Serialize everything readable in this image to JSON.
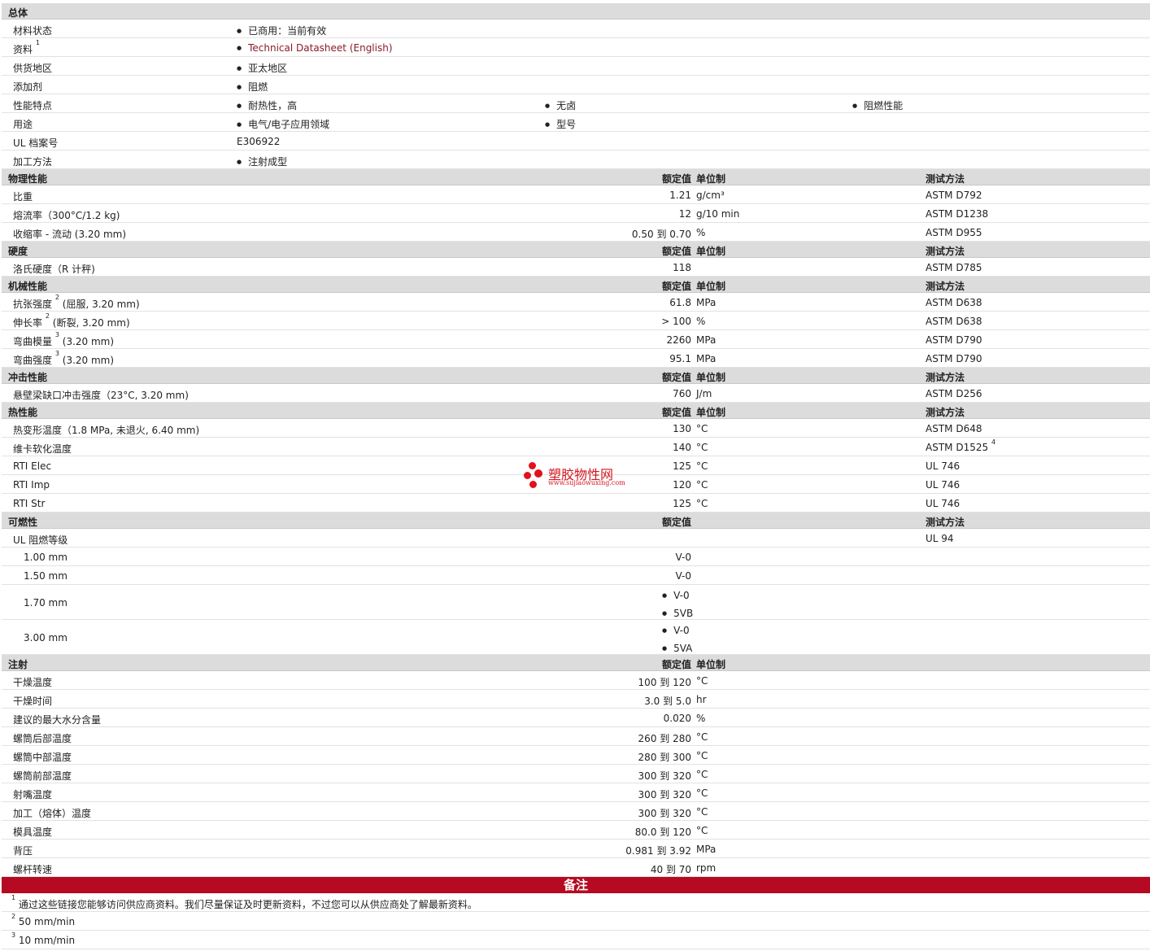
{
  "general": {
    "title": "总体",
    "status_label": "材料状态",
    "status_value": "已商用：当前有效",
    "docs_label": "资料",
    "docs_sup": "1",
    "docs_value": "Technical Datasheet (English)",
    "region_label": "供货地区",
    "region_value": "亚太地区",
    "additive_label": "添加剂",
    "additive_value": "阻燃",
    "features_label": "性能特点",
    "features": [
      "耐热性，高",
      "无卤",
      "阻燃性能"
    ],
    "uses_label": "用途",
    "uses": [
      "电气/电子应用领域",
      "型号"
    ],
    "ul_label": "UL 档案号",
    "ul_value": "E306922",
    "process_label": "加工方法",
    "process_value": "注射成型"
  },
  "headers": {
    "nominal": "额定值",
    "unit": "单位制",
    "test": "测试方法"
  },
  "physical": {
    "title": "物理性能",
    "rows": [
      {
        "label": "比重",
        "value": "1.21",
        "unit": "g/cm³",
        "test": "ASTM D792"
      },
      {
        "label": "熔流率（300°C/1.2 kg)",
        "value": "12",
        "unit": "g/10 min",
        "test": "ASTM D1238"
      },
      {
        "label": "收缩率 - 流动 (3.20 mm)",
        "value": "0.50 到  0.70",
        "unit": "%",
        "test": "ASTM D955"
      }
    ]
  },
  "hardness": {
    "title": "硬度",
    "rows": [
      {
        "label": "洛氏硬度（R 计秤)",
        "value": "118",
        "unit": "",
        "test": "ASTM D785"
      }
    ]
  },
  "mechanical": {
    "title": "机械性能",
    "rows": [
      {
        "label": "抗张强度",
        "sup": "2",
        "suffix": "(屈服, 3.20 mm)",
        "value": "61.8",
        "unit": "MPa",
        "test": "ASTM D638"
      },
      {
        "label": "伸长率",
        "sup": "2",
        "suffix": "(断裂, 3.20 mm)",
        "value": "> 100",
        "unit": "%",
        "test": "ASTM D638"
      },
      {
        "label": "弯曲模量",
        "sup": "3",
        "suffix": "(3.20 mm)",
        "value": "2260",
        "unit": "MPa",
        "test": "ASTM D790"
      },
      {
        "label": "弯曲强度",
        "sup": "3",
        "suffix": "(3.20 mm)",
        "value": "95.1",
        "unit": "MPa",
        "test": "ASTM D790"
      }
    ]
  },
  "impact": {
    "title": "冲击性能",
    "rows": [
      {
        "label": "悬壁梁缺口冲击强度（23°C, 3.20 mm)",
        "value": "760",
        "unit": "J/m",
        "test": "ASTM D256"
      }
    ]
  },
  "thermal": {
    "title": "热性能",
    "rows": [
      {
        "label": "热变形温度（1.8 MPa, 未退火, 6.40 mm)",
        "value": "130",
        "unit": "°C",
        "test": "ASTM D648"
      },
      {
        "label": "维卡软化温度",
        "value": "140",
        "unit": "°C",
        "test": "ASTM D1525",
        "test_sup": "4"
      },
      {
        "label": "RTI Elec",
        "value": "125",
        "unit": "°C",
        "test": "UL 746"
      },
      {
        "label": "RTI Imp",
        "value": "120",
        "unit": "°C",
        "test": "UL 746"
      },
      {
        "label": "RTI Str",
        "value": "125",
        "unit": "°C",
        "test": "UL 746"
      }
    ]
  },
  "flammability": {
    "title": "可燃性",
    "ul_label": "UL 阻燃等级",
    "ul_test": "UL 94",
    "r1_label": "1.00 mm",
    "r1_value": "V-0",
    "r2_label": "1.50 mm",
    "r2_value": "V-0",
    "r3_label": "1.70 mm",
    "r3_values": [
      "V-0",
      "5VB"
    ],
    "r4_label": "3.00 mm",
    "r4_values": [
      "V-0",
      "5VA"
    ]
  },
  "injection": {
    "title": "注射",
    "rows": [
      {
        "label": "干燥温度",
        "value": "100 到  120",
        "unit": "°C"
      },
      {
        "label": "干燥时间",
        "value": "3.0 到  5.0",
        "unit": "hr"
      },
      {
        "label": "建议的最大水分含量",
        "value": "0.020",
        "unit": "%"
      },
      {
        "label": "螺筒后部温度",
        "value": "260 到  280",
        "unit": "°C"
      },
      {
        "label": "螺筒中部温度",
        "value": "280 到  300",
        "unit": "°C"
      },
      {
        "label": "螺筒前部温度",
        "value": "300 到  320",
        "unit": "°C"
      },
      {
        "label": "射嘴温度",
        "value": "300 到  320",
        "unit": "°C"
      },
      {
        "label": "加工（熔体）温度",
        "value": "300 到  320",
        "unit": "°C"
      },
      {
        "label": "模具温度",
        "value": "80.0 到  120",
        "unit": "°C"
      },
      {
        "label": "背压",
        "value": "0.981 到  3.92",
        "unit": "MPa"
      },
      {
        "label": "螺杆转速",
        "value": "40 到  70",
        "unit": "rpm"
      }
    ]
  },
  "notes": {
    "title": "备注",
    "items": [
      {
        "sup": "1",
        "text": "通过这些链接您能够访问供应商资料。我们尽量保证及时更新资料，不过您可以从供应商处了解最新资料。"
      },
      {
        "sup": "2",
        "text": "50 mm/min"
      },
      {
        "sup": "3",
        "text": "10 mm/min"
      }
    ]
  },
  "watermark": {
    "name": "塑胶物性网",
    "url": "www.sujiaowuxing.com"
  }
}
